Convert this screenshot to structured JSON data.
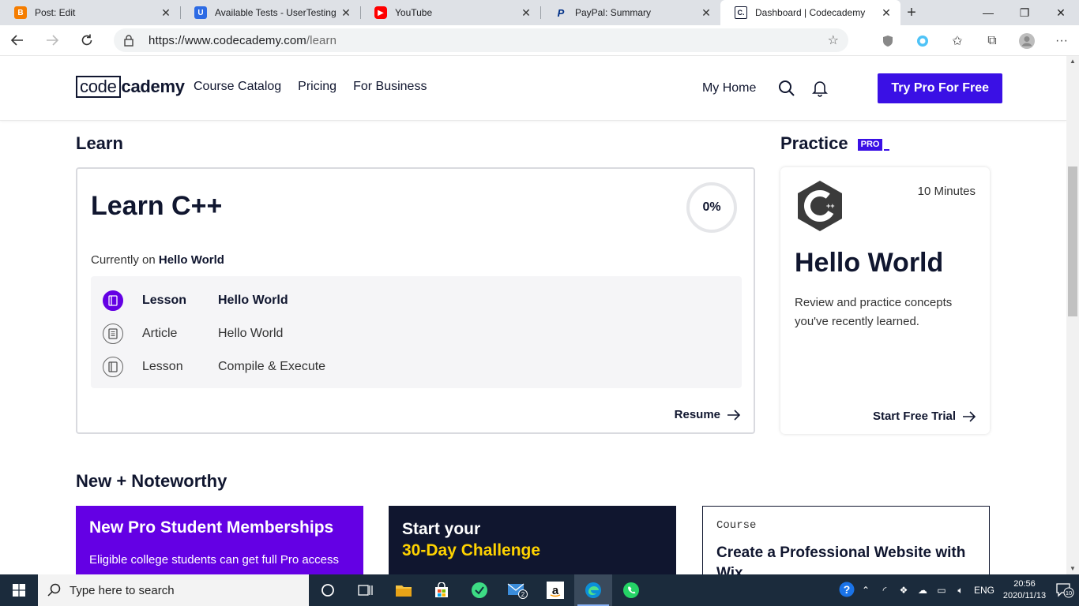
{
  "browser": {
    "tabs": [
      {
        "title": "Post: Edit",
        "favicon": "blogger-icon",
        "color": "#f57d00"
      },
      {
        "title": "Available Tests - UserTesting",
        "favicon": "usertesting-icon",
        "color": "#2d6be4"
      },
      {
        "title": "YouTube",
        "favicon": "youtube-icon",
        "color": "#ff0000"
      },
      {
        "title": "PayPal: Summary",
        "favicon": "paypal-icon",
        "color": "#003087"
      },
      {
        "title": "Dashboard | Codecademy",
        "favicon": "codecademy-icon",
        "color": "#10162f",
        "active": true
      }
    ],
    "url_host": "https://www.codecademy.com",
    "url_path": "/learn"
  },
  "site": {
    "logo_box": "code",
    "logo_rest": "cademy",
    "nav": [
      "Course Catalog",
      "Pricing",
      "For Business"
    ],
    "my_home": "My Home",
    "try_pro": "Try Pro For Free",
    "brand_color": "#3a10e5"
  },
  "learn": {
    "section_title": "Learn",
    "course_title": "Learn C++",
    "progress": "0%",
    "currently_prefix": "Currently on",
    "currently_item": "Hello World",
    "items": [
      {
        "kind": "Lesson",
        "name": "Hello World",
        "current": true
      },
      {
        "kind": "Article",
        "name": "Hello World"
      },
      {
        "kind": "Lesson",
        "name": "Compile & Execute"
      }
    ],
    "resume": "Resume"
  },
  "practice": {
    "section_title": "Practice",
    "badge": "PRO",
    "minutes": "10 Minutes",
    "title": "Hello World",
    "description": "Review and practice concepts you've recently learned.",
    "cta": "Start Free Trial"
  },
  "noteworthy": {
    "section_title": "New + Noteworthy",
    "card1": {
      "heading": "New Pro Student Memberships",
      "text": "Eligible college students can get full Pro access"
    },
    "card2": {
      "line1": "Start your",
      "line2": "30-Day Challenge"
    },
    "card3": {
      "kicker": "Course",
      "heading": "Create a Professional Website with Wix"
    }
  },
  "taskbar": {
    "search_placeholder": "Type here to search",
    "mail_badge": "2",
    "language": "ENG",
    "time": "20:56",
    "date": "2020/11/13",
    "notif_count": "10"
  }
}
